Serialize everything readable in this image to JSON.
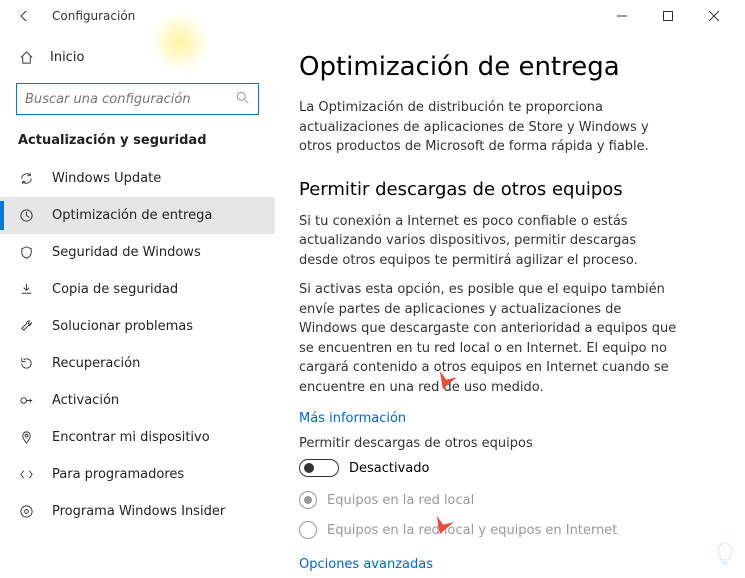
{
  "window": {
    "title": "Configuración"
  },
  "sidebar": {
    "home": "Inicio",
    "search_placeholder": "Buscar una configuración",
    "section": "Actualización y seguridad",
    "items": [
      {
        "label": "Windows Update"
      },
      {
        "label": "Optimización de entrega"
      },
      {
        "label": "Seguridad de Windows"
      },
      {
        "label": "Copia de seguridad"
      },
      {
        "label": "Solucionar problemas"
      },
      {
        "label": "Recuperación"
      },
      {
        "label": "Activación"
      },
      {
        "label": "Encontrar mi dispositivo"
      },
      {
        "label": "Para programadores"
      },
      {
        "label": "Programa Windows Insider"
      }
    ]
  },
  "main": {
    "title": "Optimización de entrega",
    "intro": "La Optimización de distribución te proporciona actualizaciones de aplicaciones de Store y Windows y otros productos de Microsoft de forma rápida y fiable.",
    "subtitle": "Permitir descargas de otros equipos",
    "p1": "Si tu conexión a Internet es poco confiable o estás actualizando varios dispositivos, permitir descargas desde otros equipos te permitirá agilizar el proceso.",
    "p2": "Si activas esta opción, es posible que el equipo también envíe partes de aplicaciones y actualizaciones de Windows que descargaste con anterioridad a equipos que se encuentren en tu red local o en Internet. El equipo no cargará contenido a otros equipos en Internet cuando se encuentre en una red de uso medido.",
    "more_info": "Más información",
    "toggle_label": "Permitir descargas de otros equipos",
    "toggle_state": "Desactivado",
    "radio1": "Equipos en la red local",
    "radio2": "Equipos en la red local y equipos en Internet",
    "advanced": "Opciones avanzadas"
  }
}
